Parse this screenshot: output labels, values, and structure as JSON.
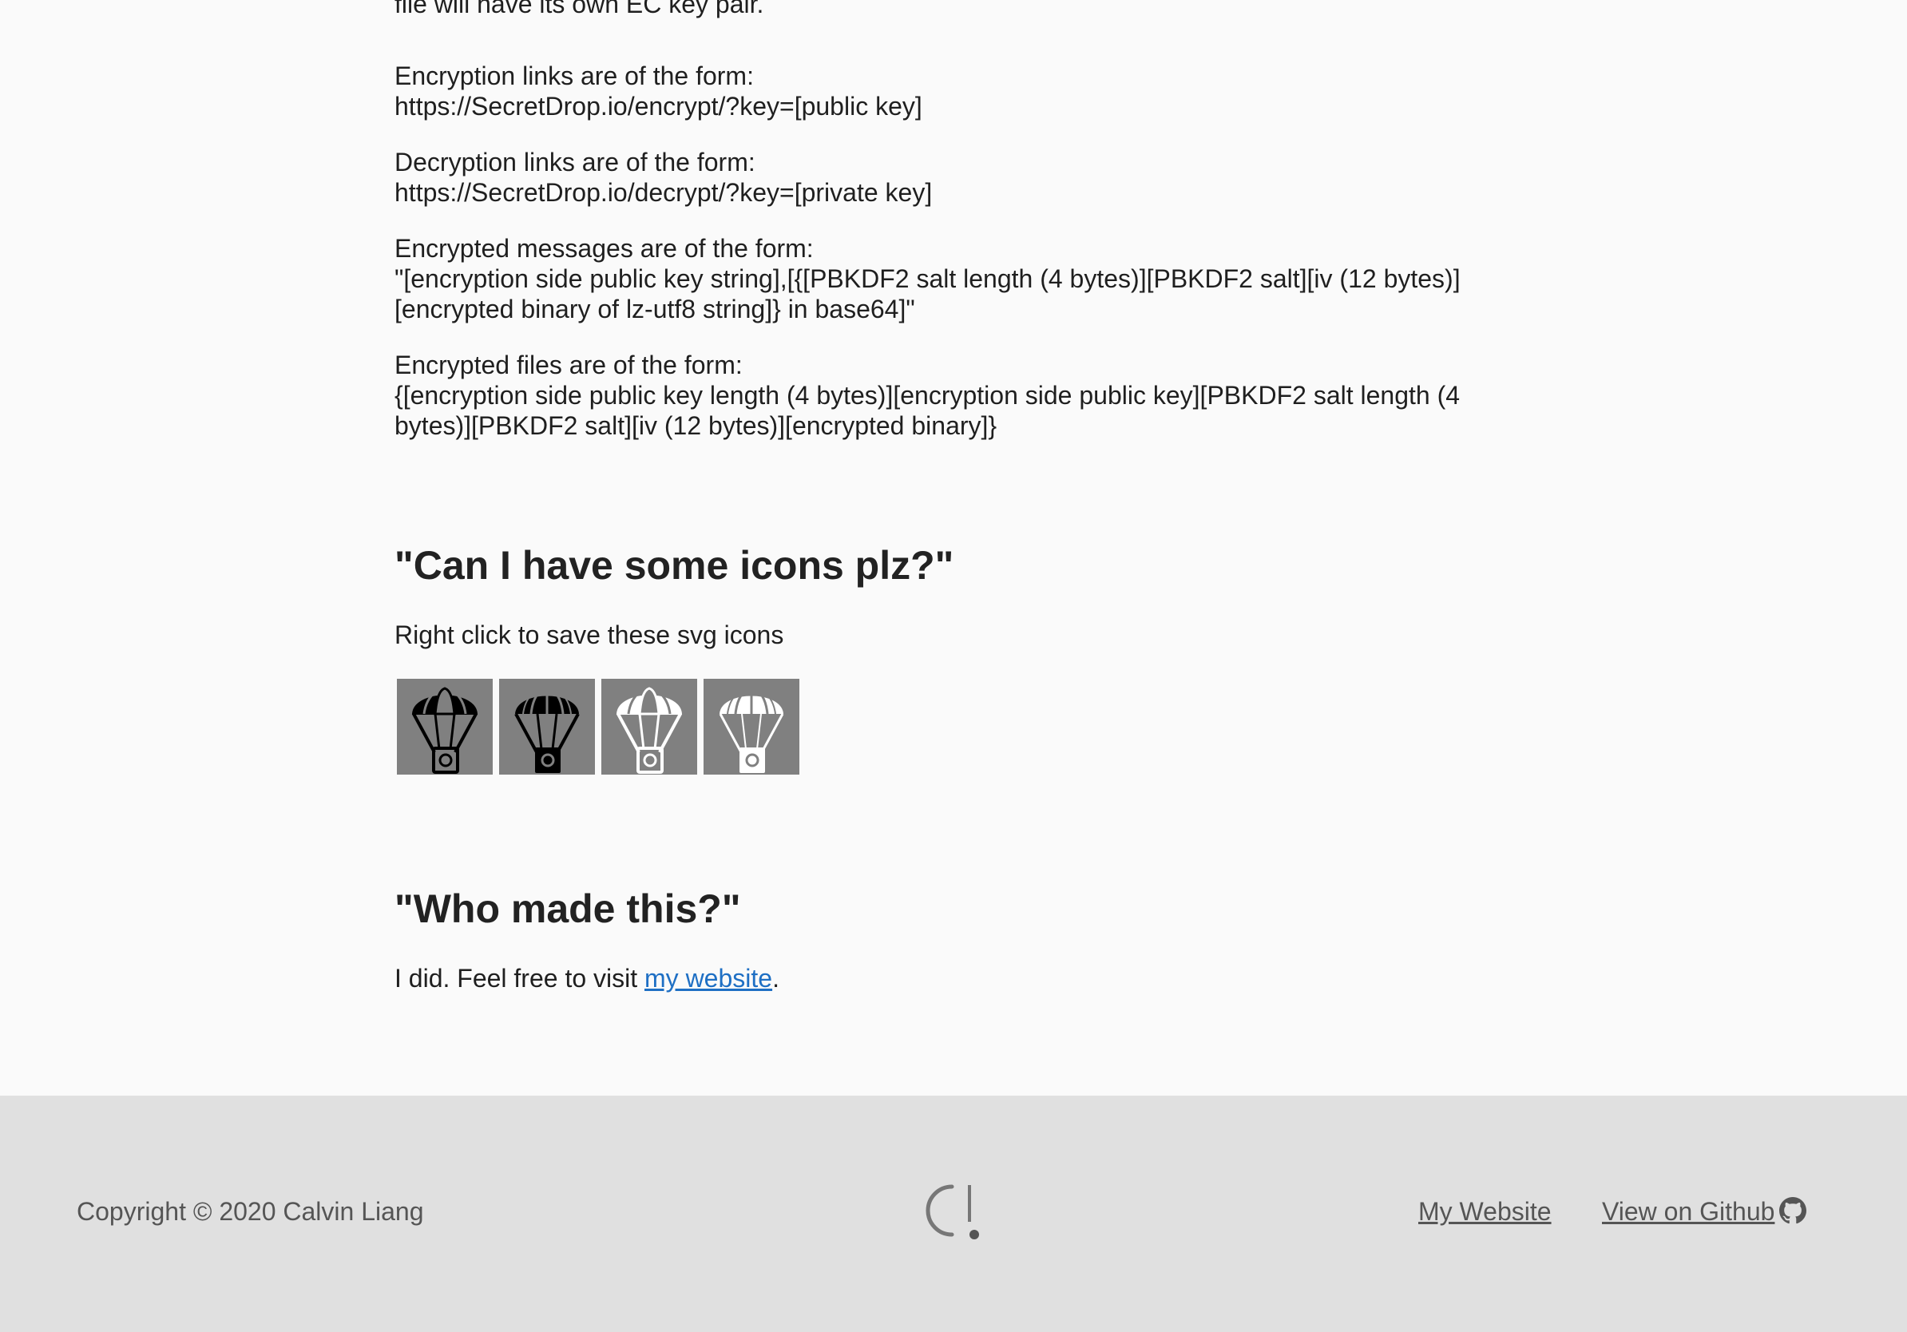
{
  "content": {
    "intro_tail": "file will have its own EC key pair.",
    "encryption_links": {
      "label": "Encryption links are of the form:",
      "format": "https://SecretDrop.io/encrypt/?key=[public key]"
    },
    "decryption_links": {
      "label": "Decryption links are of the form:",
      "format": "https://SecretDrop.io/decrypt/?key=[private key]"
    },
    "encrypted_messages": {
      "label": "Encrypted messages are of the form:",
      "format_line1": "\"[encryption side public key string],[{[PBKDF2 salt length (4 bytes)][PBKDF2 salt][iv (12 bytes)]",
      "format_line2": "[encrypted binary of lz-utf8 string]} in base64]\""
    },
    "encrypted_files": {
      "label": "Encrypted files are of the form:",
      "format_line1": "{[encryption side public key length (4 bytes)][encryption side public key][PBKDF2 salt length (4",
      "format_line2": "bytes)][PBKDF2 salt][iv (12 bytes)][encrypted binary]}"
    },
    "icons_section": {
      "heading": "\"Can I have some icons plz?\"",
      "text": "Right click to save these svg icons",
      "icons": [
        "parachute-black-outline-icon",
        "parachute-black-filled-icon",
        "parachute-white-outline-icon",
        "parachute-white-thin-icon"
      ]
    },
    "who_section": {
      "heading": "\"Who made this?\"",
      "text_before": "I did. Feel free to visit ",
      "link_text": "my website",
      "text_after": "."
    }
  },
  "footer": {
    "copyright": "Copyright © 2020 Calvin Liang",
    "my_website": "My Website",
    "github": "View on Github "
  },
  "colors": {
    "page_bg": "#fafafa",
    "footer_bg": "#e0e0e0",
    "icon_tile_bg": "#808080",
    "link": "#1e6fc4"
  }
}
